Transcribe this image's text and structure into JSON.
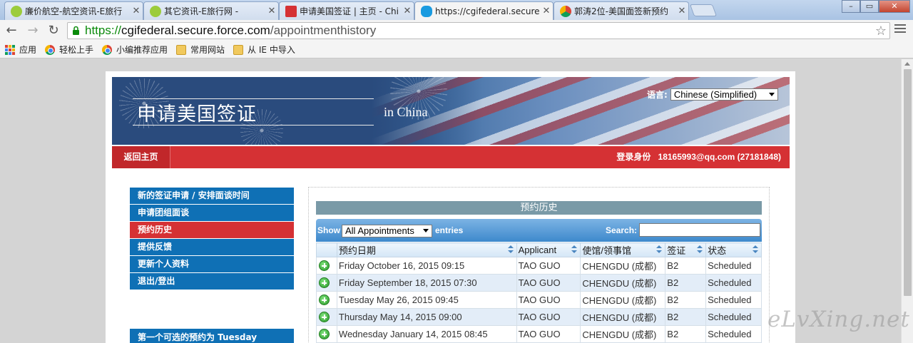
{
  "browser": {
    "tabs": [
      {
        "title": "廉价航空-航空资讯-E旅行",
        "favicon_color": "#9ccc3c"
      },
      {
        "title": "其它资讯-E旅行网 -",
        "favicon_color": "#9ccc3c"
      },
      {
        "title": "申请美国签证 | 主页 - Chi",
        "favicon_color": "#d53134"
      },
      {
        "title": "https://cgifederal.secure",
        "favicon_color": "#1a9be0"
      },
      {
        "title": "郭涛2位-美国面签新预约",
        "favicon_color": "#4285f4"
      }
    ],
    "window_buttons": {
      "minimize": "–",
      "maximize": "▭",
      "close": "✕"
    },
    "url": {
      "scheme": "https://",
      "host": "cgifederal.secure.force.com",
      "path": "/appointmenthistory"
    },
    "bookmarks": [
      {
        "label": "应用",
        "icon": "apps-icon"
      },
      {
        "label": "轻松上手",
        "icon": "chrome-icon"
      },
      {
        "label": "小编推荐应用",
        "icon": "chrome-icon"
      },
      {
        "label": "常用网站",
        "icon": "folder-icon"
      },
      {
        "label": "从 IE 中导入",
        "icon": "folder-icon"
      }
    ]
  },
  "banner": {
    "title": "申请美国签证",
    "subtitle": "in  China",
    "language_label": "语言:",
    "language_value": "Chinese (Simplified)"
  },
  "topbar": {
    "home": "返回主页",
    "login_label": "登录身份",
    "account": "18165993@qq.com (27181848)"
  },
  "sidenav": {
    "items": [
      {
        "label": "新的签证申请 / 安排面谈时间",
        "active": false
      },
      {
        "label": "申请团组面谈",
        "active": false
      },
      {
        "label": "预约历史",
        "active": true
      },
      {
        "label": "提供反馈",
        "active": false
      },
      {
        "label": "更新个人资料",
        "active": false
      },
      {
        "label": "退出/登出",
        "active": false
      }
    ],
    "next_appointment": "第一个可选的预约为 Tuesday"
  },
  "history": {
    "title": "预约历史",
    "show_label": "Show",
    "show_value": "All Appointments",
    "entries_label": "entries",
    "search_label": "Search:",
    "search_value": "",
    "columns": [
      "",
      "预约日期",
      "Applicant",
      "使馆/领事馆",
      "签证",
      "状态"
    ],
    "rows": [
      {
        "date": "Friday October 16, 2015 09:15",
        "applicant": "TAO GUO",
        "post": "CHENGDU (成都)",
        "visa": "B2",
        "status": "Scheduled"
      },
      {
        "date": "Friday September 18, 2015 07:30",
        "applicant": "TAO GUO",
        "post": "CHENGDU (成都)",
        "visa": "B2",
        "status": "Scheduled"
      },
      {
        "date": "Tuesday May 26, 2015 09:45",
        "applicant": "TAO GUO",
        "post": "CHENGDU (成都)",
        "visa": "B2",
        "status": "Scheduled"
      },
      {
        "date": "Thursday May 14, 2015 09:00",
        "applicant": "TAO GUO",
        "post": "CHENGDU (成都)",
        "visa": "B2",
        "status": "Scheduled"
      },
      {
        "date": "Wednesday January 14, 2015 08:45",
        "applicant": "TAO GUO",
        "post": "CHENGDU (成都)",
        "visa": "B2",
        "status": "Scheduled"
      }
    ]
  },
  "watermark": "eLvXing.net"
}
